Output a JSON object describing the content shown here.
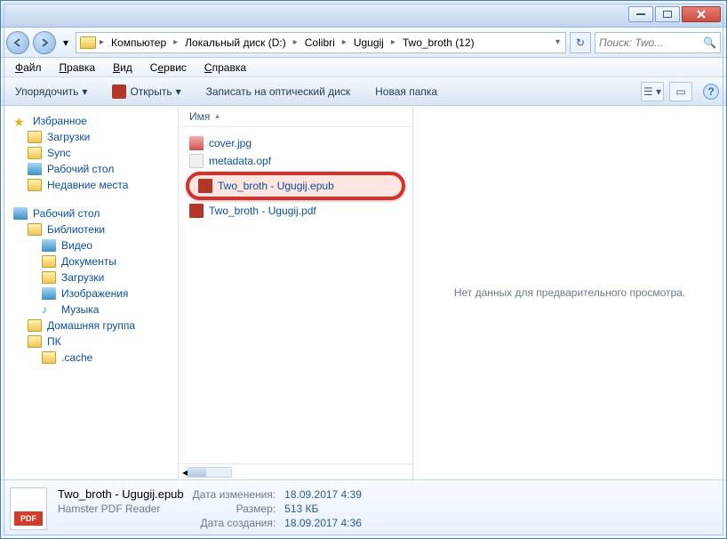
{
  "breadcrumbs": [
    "Компьютер",
    "Локальный диск (D:)",
    "Colibri",
    "Ugugij",
    "Two_broth (12)"
  ],
  "search": {
    "placeholder": "Поиск: Two..."
  },
  "menu": {
    "file": "Файл",
    "edit": "Правка",
    "view": "Вид",
    "tools": "Сервис",
    "help": "Справка"
  },
  "toolbar": {
    "organize": "Упорядочить",
    "open": "Открыть",
    "burn": "Записать на оптический диск",
    "newfolder": "Новая папка"
  },
  "sidebar": {
    "favorites": {
      "label": "Избранное",
      "items": [
        "Загрузки",
        "Sync",
        "Рабочий стол",
        "Недавние места"
      ]
    },
    "desktop": {
      "label": "Рабочий стол",
      "libs": "Библиотеки",
      "items": [
        "Видео",
        "Документы",
        "Загрузки",
        "Изображения",
        "Музыка"
      ],
      "homegroup": "Домашняя группа",
      "pc": "ПК",
      "cache": ".cache"
    }
  },
  "column": {
    "name": "Имя"
  },
  "files": {
    "f0": "cover.jpg",
    "f1": "metadata.opf",
    "f2": "Two_broth - Ugugij.epub",
    "f3": "Two_broth - Ugugij.pdf"
  },
  "preview": {
    "empty": "Нет данных для предварительного просмотра."
  },
  "details": {
    "name": "Two_broth - Ugugij.epub",
    "app": "Hamster PDF Reader",
    "icon_text": "PDF",
    "modified_label": "Дата изменения:",
    "modified": "18.09.2017 4:39",
    "size_label": "Размер:",
    "size": "513 КБ",
    "created_label": "Дата создания:",
    "created": "18.09.2017 4:36"
  }
}
